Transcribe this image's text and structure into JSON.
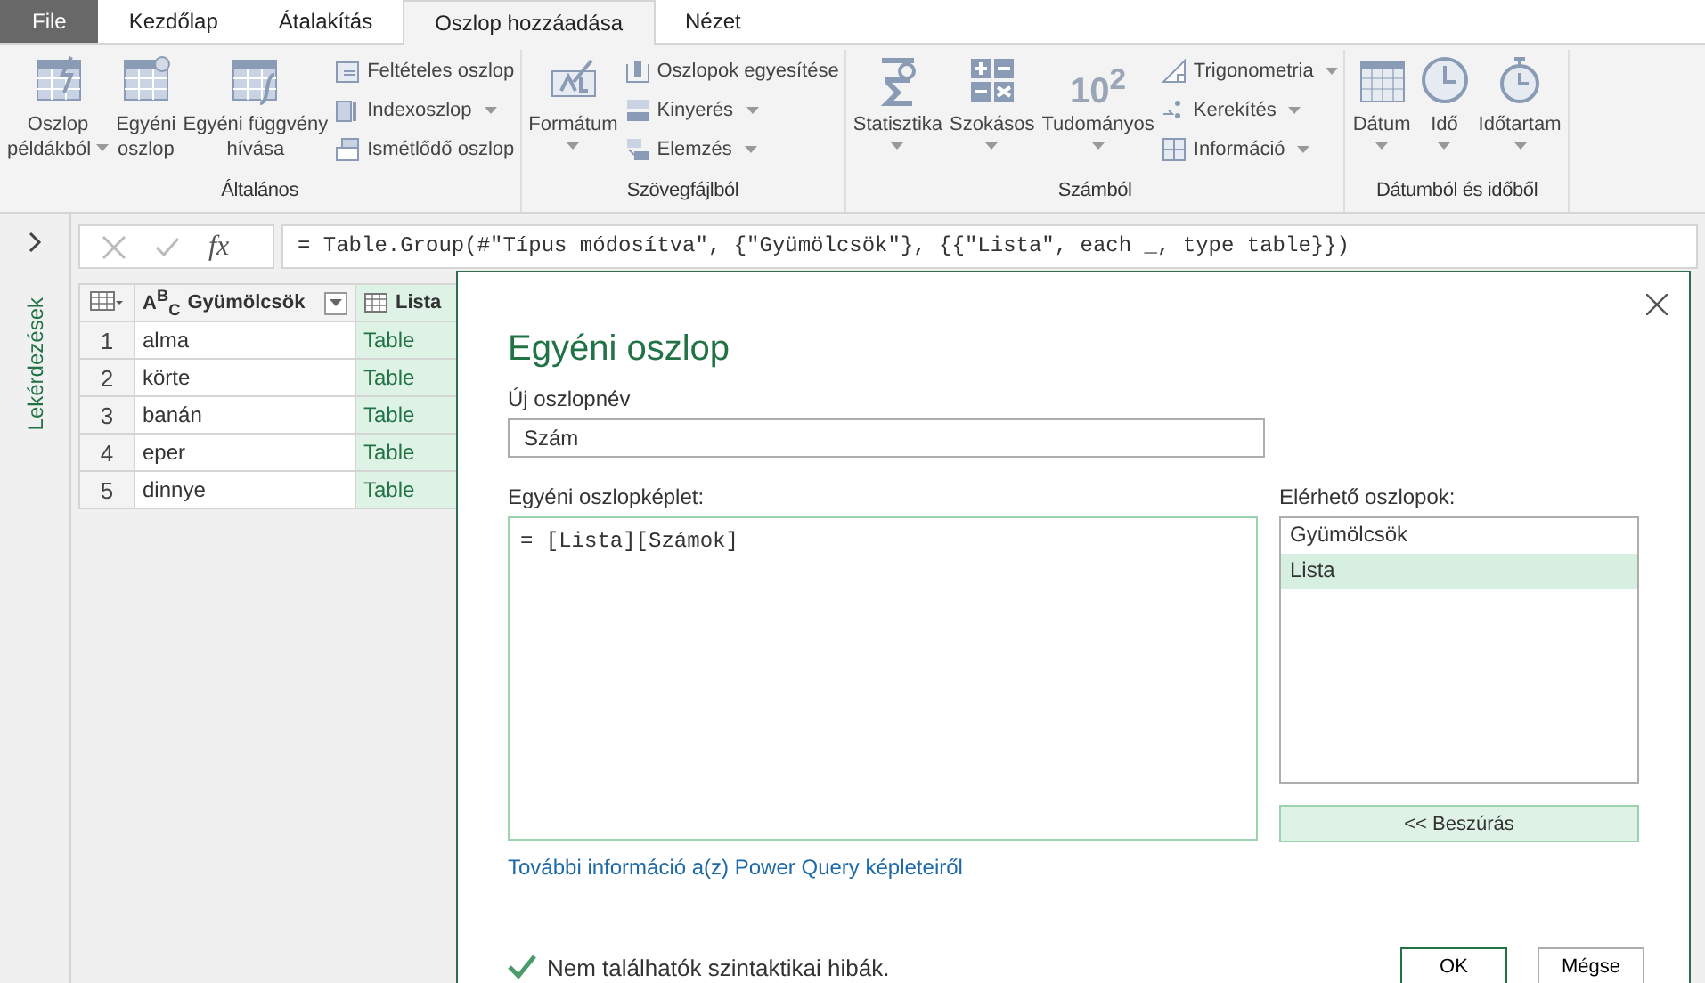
{
  "ribbon": {
    "tabs": [
      {
        "label": "File",
        "kind": "file",
        "selected": false
      },
      {
        "label": "Kezdőlap",
        "kind": "tab",
        "selected": false
      },
      {
        "label": "Átalakítás",
        "kind": "tab",
        "selected": false
      },
      {
        "label": "Oszlop hozzáadása",
        "kind": "tab",
        "selected": true
      },
      {
        "label": "Nézet",
        "kind": "tab",
        "selected": false
      }
    ],
    "groups": [
      {
        "label": "Általános",
        "large": [
          {
            "lines": [
              "Oszlop",
              "példákból"
            ],
            "dropdown": true
          },
          {
            "lines": [
              "Egyéni",
              "oszlop"
            ],
            "dropdown": false
          },
          {
            "lines": [
              "Egyéni függvény",
              "hívása"
            ],
            "dropdown": false
          }
        ],
        "small": [
          {
            "label": "Feltételes oszlop",
            "dropdown": false
          },
          {
            "label": "Indexoszlop",
            "dropdown": true
          },
          {
            "label": "Ismétlődő oszlop",
            "dropdown": false
          }
        ]
      },
      {
        "label": "Szövegfájlból",
        "large": [
          {
            "lines": [
              "Formátum"
            ],
            "dropdown": true
          }
        ],
        "small": [
          {
            "label": "Oszlopok egyesítése",
            "dropdown": false
          },
          {
            "label": "Kinyerés",
            "dropdown": true
          },
          {
            "label": "Elemzés",
            "dropdown": true
          }
        ]
      },
      {
        "label": "Számból",
        "large": [
          {
            "lines": [
              "Statisztika"
            ],
            "dropdown": true
          },
          {
            "lines": [
              "Szokásos"
            ],
            "dropdown": true
          },
          {
            "lines": [
              "Tudományos"
            ],
            "dropdown": true,
            "icon_text": "10$^{2}$"
          }
        ],
        "small": [
          {
            "label": "Trigonometria",
            "dropdown": true
          },
          {
            "label": "Kerekítés",
            "dropdown": true
          },
          {
            "label": "Információ",
            "dropdown": true
          }
        ]
      },
      {
        "label": "Dátumból és időből",
        "large": [
          {
            "lines": [
              "Dátum"
            ],
            "dropdown": true
          },
          {
            "lines": [
              "Idő"
            ],
            "dropdown": true
          },
          {
            "lines": [
              "Időtartam"
            ],
            "dropdown": true
          }
        ]
      }
    ]
  },
  "sidebar": {
    "label": "Lekérdezések"
  },
  "formula_bar": {
    "fx_label": "fx",
    "formula": "= Table.Group(#\"Típus módosítva\", {\"Gyümölcsök\"}, {{\"Lista\", each _, type table}})"
  },
  "table": {
    "columns": [
      {
        "label": "Gyümölcsök",
        "type_label": "A$^{B}$$_{C}$",
        "kind": "text"
      },
      {
        "label": "Lista",
        "kind": "table"
      }
    ],
    "rows": [
      {
        "number": "1",
        "cells": [
          "alma",
          "Table"
        ]
      },
      {
        "number": "2",
        "cells": [
          "körte",
          "Table"
        ]
      },
      {
        "number": "3",
        "cells": [
          "banán",
          "Table"
        ]
      },
      {
        "number": "4",
        "cells": [
          "eper",
          "Table"
        ]
      },
      {
        "number": "5",
        "cells": [
          "dinnye",
          "Table"
        ]
      }
    ]
  },
  "dialog": {
    "title": "Egyéni oszlop",
    "name_label": "Új oszlopnév",
    "name_value": "Szám",
    "formula_label": "Egyéni oszlopképlet:",
    "formula_value": "= [Lista][Számok]",
    "columns_label": "Elérhető oszlopok:",
    "available_columns": [
      {
        "label": "Gyümölcsök",
        "selected": false
      },
      {
        "label": "Lista",
        "selected": true
      }
    ],
    "insert_button": "<< Beszúrás",
    "help_link": "További információ a(z) Power Query képleteiről",
    "status": "Nem találhatók szintaktikai hibák.",
    "ok": "OK",
    "cancel": "Mégse"
  }
}
